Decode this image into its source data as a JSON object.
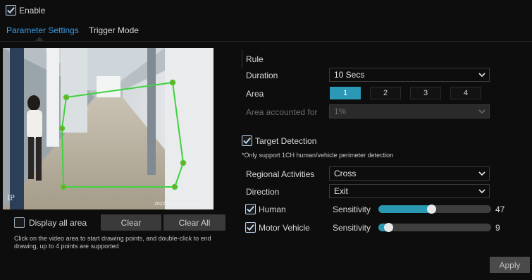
{
  "enable": {
    "label": "Enable",
    "checked": true
  },
  "tabs": [
    {
      "label": "Parameter Settings",
      "active": true
    },
    {
      "label": "Trigger Mode",
      "active": false
    }
  ],
  "video": {
    "camera_tag": "IP",
    "timestamp": "2022/10/14 15:22:15"
  },
  "left_panel": {
    "display_all_area": {
      "label": "Display all area",
      "checked": false
    },
    "clear_label": "Clear",
    "clear_all_label": "Clear All",
    "hint": "Click on the video area to start drawing points, and double-click to end drawing, up to 4 points are supported"
  },
  "rule": {
    "title": "Rule",
    "duration": {
      "label": "Duration",
      "value": "10 Secs"
    },
    "area": {
      "label": "Area",
      "options": [
        "1",
        "2",
        "3",
        "4"
      ],
      "selected": "1"
    },
    "area_accounted": {
      "label": "Area accounted for",
      "value": "1%"
    }
  },
  "target_detection": {
    "label": "Target Detection",
    "checked": true,
    "note": "*Only support 1CH human/vehicle perimeter detection",
    "regional_activities": {
      "label": "Regional Activities",
      "value": "Cross"
    },
    "direction": {
      "label": "Direction",
      "value": "Exit"
    },
    "human": {
      "label": "Human",
      "checked": true,
      "sensitivity_label": "Sensitivity",
      "sensitivity": 47,
      "max": 100
    },
    "motor_vehicle": {
      "label": "Motor Vehicle",
      "checked": true,
      "sensitivity_label": "Sensitivity",
      "sensitivity": 9,
      "max": 100
    }
  },
  "apply_label": "Apply",
  "colors": {
    "accent": "#3aa0e8",
    "area_active": "#2b98b6",
    "slider_fill": "#2a97b3",
    "polygon": "#3fd23f"
  }
}
